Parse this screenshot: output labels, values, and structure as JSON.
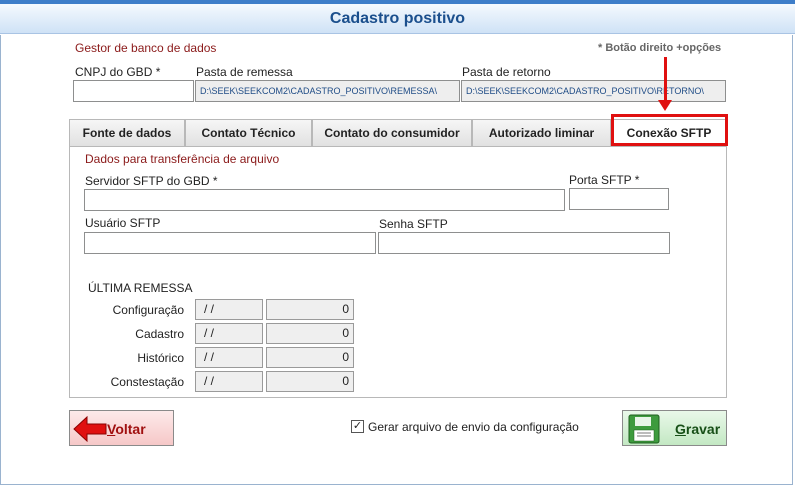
{
  "window": {
    "title": "Cadastro positivo"
  },
  "header": {
    "section_label": "Gestor de banco de dados",
    "hint": "* Botão direito +opções"
  },
  "fields": {
    "cnpj_label": "CNPJ do GBD *",
    "cnpj_value": "",
    "remessa_label": "Pasta de remessa",
    "remessa_value": "D:\\SEEK\\SEEKCOM2\\CADASTRO_POSITIVO\\REMESSA\\",
    "retorno_label": "Pasta de retorno",
    "retorno_value": "D:\\SEEK\\SEEKCOM2\\CADASTRO_POSITIVO\\RETORNO\\"
  },
  "tabs": [
    {
      "label": "Fonte de dados"
    },
    {
      "label": "Contato Técnico"
    },
    {
      "label": "Contato do consumidor"
    },
    {
      "label": "Autorizado liminar"
    },
    {
      "label": "Conexão SFTP"
    }
  ],
  "active_tab": "Conexão SFTP",
  "sftp": {
    "section_label": "Dados para transferência de arquivo",
    "server_label": "Servidor SFTP do GBD *",
    "server_value": "",
    "port_label": "Porta SFTP *",
    "port_value": "",
    "user_label": "Usuário SFTP",
    "user_value": "",
    "password_label": "Senha SFTP",
    "password_value": ""
  },
  "ultima_remessa": {
    "title": "ÚLTIMA REMESSA",
    "rows": [
      {
        "label": "Configuração",
        "date": "/ /",
        "count": "0"
      },
      {
        "label": "Cadastro",
        "date": "/ /",
        "count": "0"
      },
      {
        "label": "Histórico",
        "date": "/ /",
        "count": "0"
      },
      {
        "label": "Constestação",
        "date": "/ /",
        "count": "0"
      }
    ]
  },
  "footer": {
    "back_label_u": "V",
    "back_label_rest": "oltar",
    "checkbox_label": "Gerar arquivo de envio da configuração",
    "checkbox_checked": true,
    "save_label_u": "G",
    "save_label_rest": "ravar"
  },
  "colors": {
    "title": "#1b4f8d",
    "section_label": "#8b1a1a",
    "highlight": "#e01010",
    "path_text": "#1f4c86"
  }
}
